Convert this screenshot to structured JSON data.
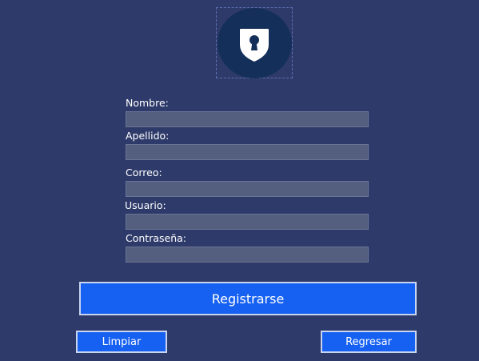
{
  "logo": {
    "icon": "shield-lock-icon",
    "circle_color": "#14305a"
  },
  "form": {
    "fields": [
      {
        "label": "Nombre:",
        "value": "",
        "placeholder": ""
      },
      {
        "label": "Apellido:",
        "value": "",
        "placeholder": ""
      },
      {
        "label": "Correo:",
        "value": "",
        "placeholder": ""
      },
      {
        "label": "Usuario:",
        "value": "",
        "placeholder": ""
      },
      {
        "label": "Contraseña:",
        "value": "",
        "placeholder": ""
      }
    ]
  },
  "buttons": {
    "register_label": "Registrarse",
    "clear_label": "Limpiar",
    "back_label": "Regresar"
  },
  "colors": {
    "background": "#2e3a6a",
    "input_background": "#545e7e",
    "button_accent": "#1761f2"
  }
}
